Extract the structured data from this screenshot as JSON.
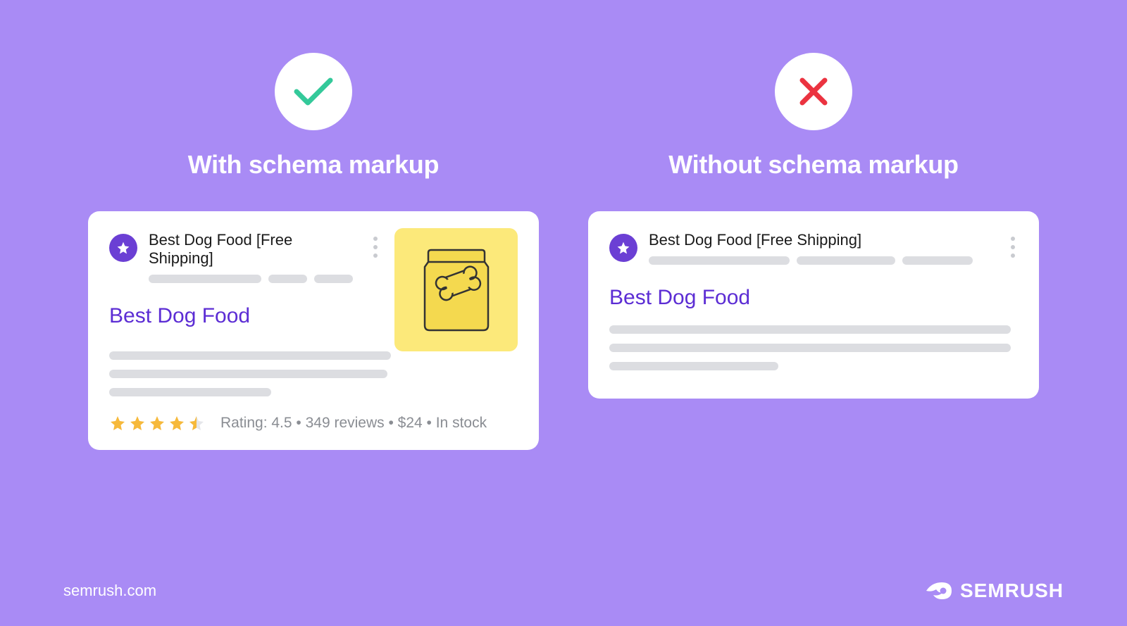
{
  "left": {
    "title": "With schema markup",
    "crumb_title": "Best Dog Food [Free Shipping]",
    "result_title": "Best Dog Food",
    "rating_text": "Rating: 4.5 • 349 reviews • $24 • In stock",
    "rating_value": 4.5,
    "review_count": 349,
    "price": "$24",
    "stock": "In stock"
  },
  "right": {
    "title": "Without schema markup",
    "crumb_title": "Best Dog Food [Free Shipping]",
    "result_title": "Best Dog Food"
  },
  "footer": {
    "url": "semrush.com",
    "brand": "SEMRUSH"
  },
  "colors": {
    "bg": "#a98bf5",
    "accent": "#6b3fd4",
    "check": "#34c99a",
    "cross": "#eb3340",
    "star": "#f6b93b",
    "thumb": "#fce97a"
  }
}
